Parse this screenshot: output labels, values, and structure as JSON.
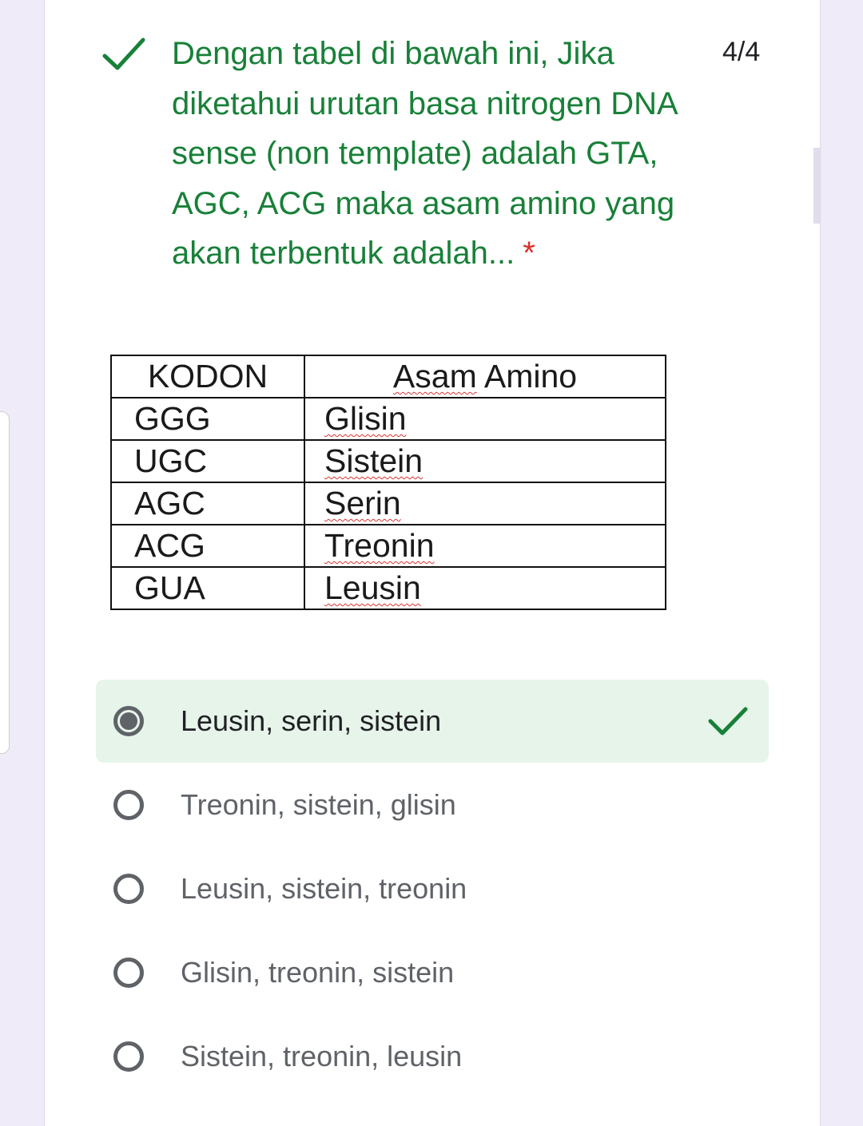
{
  "question": {
    "title": "Dengan tabel di bawah ini, Jika diketahui urutan basa nitrogen DNA sense (non template) adalah GTA, AGC, ACG maka asam amino yang akan terbentuk adalah...",
    "required_mark": "*",
    "score": "4/4",
    "status_icon": "check-icon",
    "accent_color": "#188038"
  },
  "table": {
    "headers": [
      "KODON",
      "Asam Amino"
    ],
    "rows": [
      [
        "GGG",
        "Glisin"
      ],
      [
        "UGC",
        "Sistein"
      ],
      [
        "AGC",
        "Serin"
      ],
      [
        "ACG",
        "Treonin"
      ],
      [
        "GUA",
        "Leusin"
      ]
    ]
  },
  "options": [
    {
      "label": "Leusin, serin, sistein",
      "selected": true,
      "correct": true
    },
    {
      "label": "Treonin, sistein, glisin",
      "selected": false
    },
    {
      "label": "Leusin, sistein, treonin",
      "selected": false
    },
    {
      "label": "Glisin, treonin, sistein",
      "selected": false
    },
    {
      "label": "Sistein, treonin, leusin",
      "selected": false
    }
  ]
}
